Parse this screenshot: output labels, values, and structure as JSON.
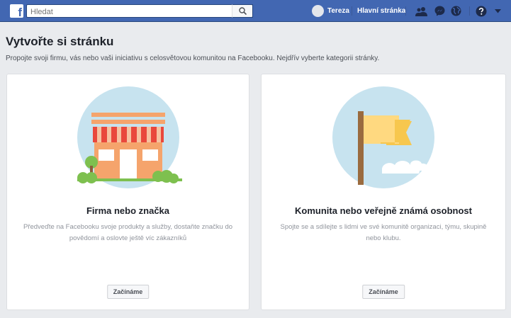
{
  "topbar": {
    "logo_letter": "f",
    "search_placeholder": "Hledat",
    "user_name": "Tereza",
    "home_label": "Hlavní stránka"
  },
  "page": {
    "title": "Vytvořte si stránku",
    "subtitle": "Propojte svoji firmu, vás nebo vaši iniciativu s celosvětovou komunitou na Facebooku. Nejdřív vyberte kategorii stránky."
  },
  "cards": [
    {
      "title": "Firma nebo značka",
      "description": "Předveďte na Facebooku svoje produkty a služby, dostaňte značku do povědomí a oslovte ještě víc zákazníků",
      "button": "Začínáme"
    },
    {
      "title": "Komunita nebo veřejně známá osobnost",
      "description": "Spojte se a sdílejte s lidmi ve své komunitě organizaci, týmu, skupině nebo klubu.",
      "button": "Začínáme"
    }
  ],
  "colors": {
    "brand": "#4267b2",
    "illustration_bg": "#c7e3ef",
    "awning_red": "#e9483c",
    "shop_orange": "#f5a46c",
    "flag_yellow": "#ffd980",
    "tree_green": "#7ec04f"
  }
}
